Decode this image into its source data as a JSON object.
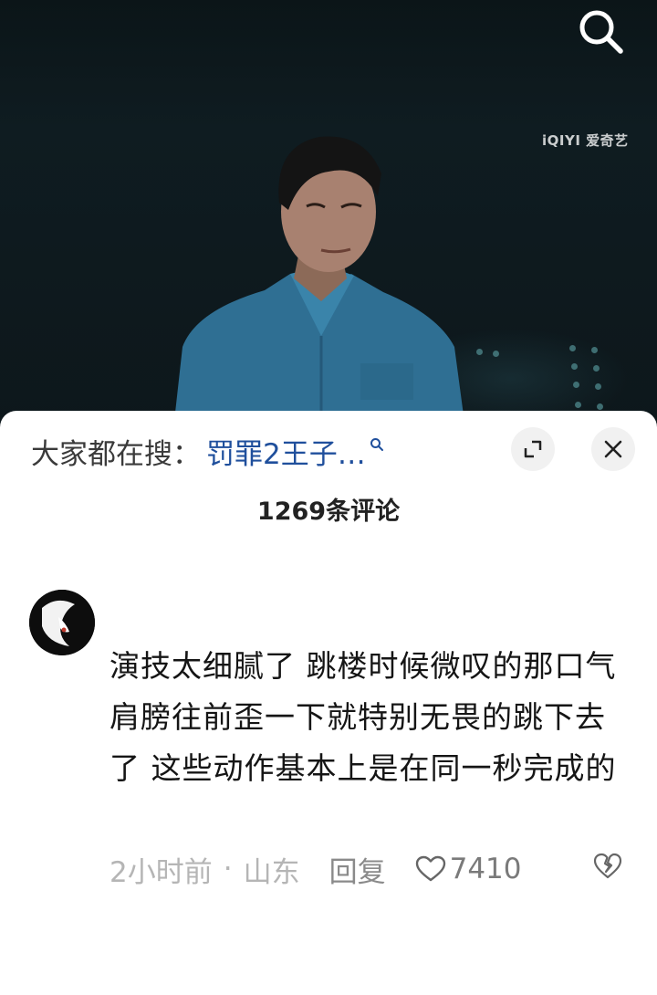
{
  "video": {
    "watermark": "iQIYI 爱奇艺"
  },
  "hot_search": {
    "prefix": "大家都在搜：",
    "query": "罚罪2王子…"
  },
  "comments_header": {
    "count_label": "1269条评论"
  },
  "comment": {
    "text": "演技太细腻了 跳楼时候微叹的那口气 肩膀往前歪一下就特别无畏的跳下去了 这些动作基本上是在同一秒完成的",
    "time": "2小时前",
    "separator": "·",
    "location": "山东",
    "reply_label": "回复",
    "like_count": "7410"
  },
  "colors": {
    "link_blue": "#1f4f9c",
    "meta_gray": "#b5b5b5",
    "text_dark": "#151515"
  },
  "icons": [
    "search-icon",
    "magnifier-small-icon",
    "expand-icon",
    "close-icon",
    "heart-icon",
    "broken-heart-icon"
  ]
}
